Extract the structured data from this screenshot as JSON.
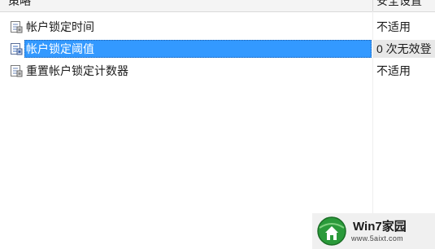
{
  "header": {
    "policy_label": "策略",
    "setting_label": "安全设置"
  },
  "rows": [
    {
      "name": "帐户锁定时间",
      "value": "不适用",
      "selected": false,
      "icon": "policy-icon"
    },
    {
      "name": "帐户锁定阈值",
      "value": "0 次无效登",
      "selected": true,
      "icon": "policy-icon"
    },
    {
      "name": "重置帐户锁定计数器",
      "value": "不适用",
      "selected": false,
      "icon": "policy-icon"
    }
  ],
  "watermark": {
    "title": "Win7家园",
    "url": "www.5aixt.com",
    "icon": "globe-house-icon"
  },
  "colors": {
    "selection": "#3399ff",
    "icon_blue": "#5577aa"
  }
}
